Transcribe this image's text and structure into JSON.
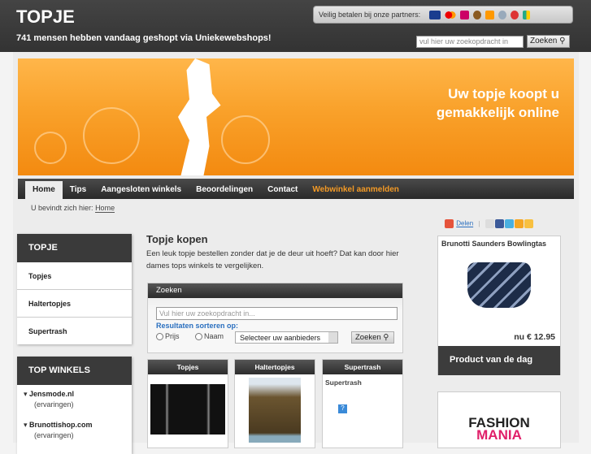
{
  "header": {
    "logo": "TOPJE",
    "tagline": "741 mensen hebben vandaag geshopt via Uniekewebshops!",
    "partners_label": "Veilig betalen bij onze partners:",
    "partner_icons": [
      "visa-icon",
      "mastercard-icon",
      "ideal-icon",
      "bank-icon",
      "lion-icon",
      "star-bank-icon",
      "flower-icon",
      "abn-icon"
    ],
    "search_placeholder": "vul hier uw zoekopdracht in",
    "search_button": "Zoeken"
  },
  "banner": {
    "line1": "Uw topje koopt u",
    "line2": "gemakkelijk online"
  },
  "nav": [
    "Home",
    "Tips",
    "Aangesloten winkels",
    "Beoordelingen",
    "Contact",
    "Webwinkel aanmelden"
  ],
  "breadcrumb": {
    "label": "U bevindt zich hier:",
    "current": "Home"
  },
  "sidebar": {
    "title": "TOPJE",
    "items": [
      "Topjes",
      "Haltertopjes",
      "Supertrash"
    ],
    "top_title": "TOP WINKELS",
    "shops": [
      {
        "name": "Jensmode.nl",
        "sub": "(ervaringen)"
      },
      {
        "name": "Brunottishop.com",
        "sub": "(ervaringen)"
      }
    ]
  },
  "main": {
    "title": "Topje kopen",
    "intro": "Een leuk topje bestellen zonder dat je de deur uit hoeft? Dat kan door hier dames tops winkels te vergelijken.",
    "search": {
      "title": "Zoeken",
      "placeholder": "Vul hier uw zoekopdracht in...",
      "sort_label": "Resultaten sorteren op:",
      "opt_price": "Prijs",
      "opt_name": "Naam",
      "select": "Selecteer uw aanbieders",
      "button": "Zoeken"
    },
    "cards": [
      {
        "title": "Topjes"
      },
      {
        "title": "Haltertopjes"
      },
      {
        "title": "Supertrash",
        "text": "Supertrash"
      }
    ]
  },
  "right": {
    "share": "Delen",
    "product_name": "Brunotti Saunders Bowlingtas",
    "price": "nu € 12.95",
    "footer": "Product van de dag",
    "ad": {
      "line1": "FASHION",
      "line2": "MANIA"
    }
  },
  "colors": {
    "orange": "#f39a26",
    "dark": "#3a3a3a",
    "link": "#2a6fbf"
  }
}
